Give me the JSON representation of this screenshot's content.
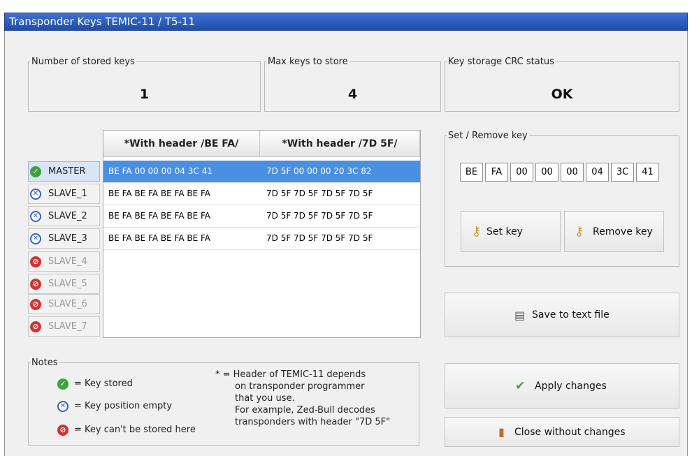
{
  "window": {
    "title": "Transponder Keys TEMIC-11 / T5-11"
  },
  "stats": {
    "stored": {
      "label": "Number of stored keys",
      "value": "1"
    },
    "max": {
      "label": "Max keys to store",
      "value": "4"
    },
    "crc": {
      "label": "Key storage CRC status",
      "value": "OK"
    }
  },
  "table": {
    "headers": [
      "*With header /BE FA/",
      "*With header /7D 5F/"
    ],
    "rows": [
      [
        "BE FA 00 00 00 04 3C 41",
        "7D 5F 00 00 00 20 3C 82"
      ],
      [
        "BE FA BE FA BE FA BE FA",
        "7D 5F 7D 5F 7D 5F 7D 5F"
      ],
      [
        "BE FA BE FA BE FA BE FA",
        "7D 5F 7D 5F 7D 5F 7D 5F"
      ],
      [
        "BE FA BE FA BE FA BE FA",
        "7D 5F 7D 5F 7D 5F 7D 5F"
      ]
    ]
  },
  "slots": [
    {
      "label": "MASTER",
      "icon": "check-circle-icon"
    },
    {
      "label": "SLAVE_1",
      "icon": "x-circle-icon"
    },
    {
      "label": "SLAVE_2",
      "icon": "x-circle-icon"
    },
    {
      "label": "SLAVE_3",
      "icon": "x-circle-icon"
    },
    {
      "label": "SLAVE_4",
      "icon": "no-entry-icon"
    },
    {
      "label": "SLAVE_5",
      "icon": "no-entry-icon"
    },
    {
      "label": "SLAVE_6",
      "icon": "no-entry-icon"
    },
    {
      "label": "SLAVE_7",
      "icon": "no-entry-icon"
    }
  ],
  "set_remove": {
    "label": "Set / Remove key",
    "bytes": [
      "BE",
      "FA",
      "00",
      "00",
      "00",
      "04",
      "3C",
      "41"
    ],
    "set_button": "Set key",
    "remove_button": "Remove key"
  },
  "buttons": {
    "save": "Save to text file",
    "apply": "Apply changes",
    "close": "Close without changes"
  },
  "notes": {
    "label": "Notes",
    "stored": "= Key stored",
    "empty": "= Key position empty",
    "cant": "= Key can't be stored here",
    "footnote": [
      "* = Header of TEMIC-11 depends",
      "on transponder programmer",
      "that you use.",
      "For example, Zed-Bull decodes",
      "transponders with header \"7D 5F\""
    ]
  },
  "colors": {
    "title_bar": "#2a5bc0",
    "selected_row": "#4a90e2",
    "stored": "#3aa53a",
    "empty": "#3b63c5",
    "blocked": "#d63030"
  }
}
